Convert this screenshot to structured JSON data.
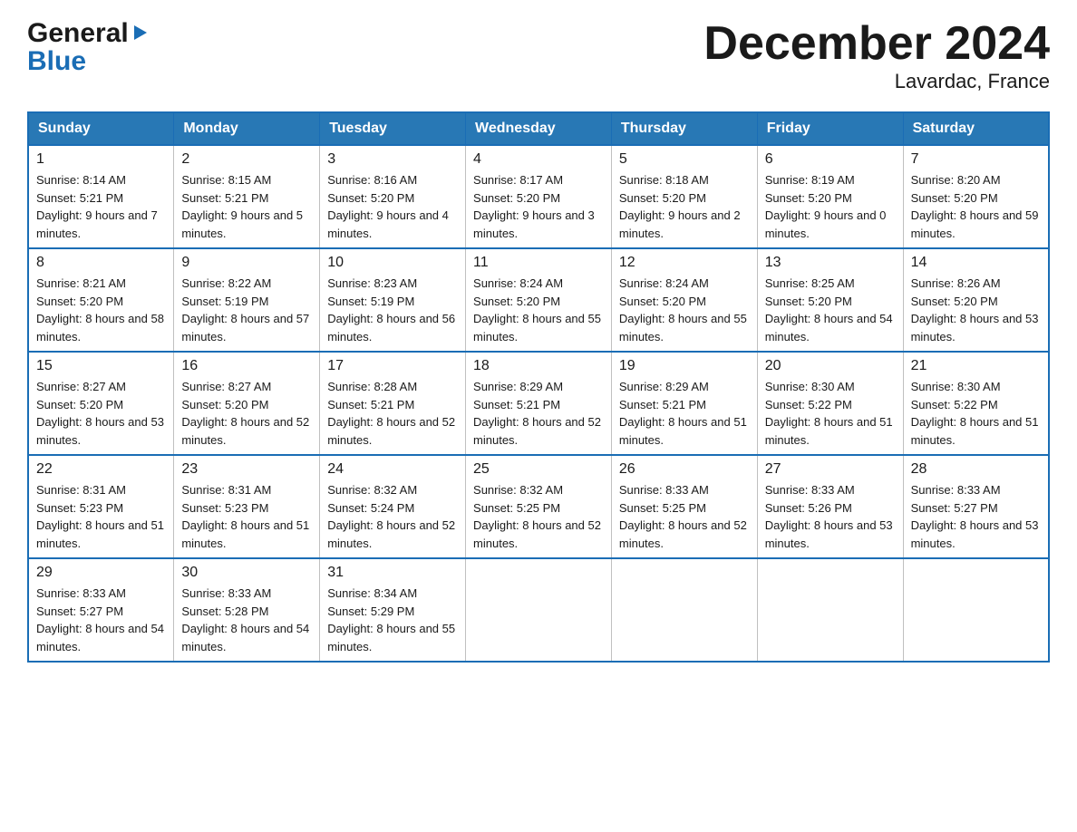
{
  "logo": {
    "general": "General",
    "triangle": "▶",
    "blue": "Blue"
  },
  "title": "December 2024",
  "subtitle": "Lavardac, France",
  "days": [
    "Sunday",
    "Monday",
    "Tuesday",
    "Wednesday",
    "Thursday",
    "Friday",
    "Saturday"
  ],
  "weeks": [
    [
      {
        "num": "1",
        "sunrise": "8:14 AM",
        "sunset": "5:21 PM",
        "daylight": "9 hours and 7 minutes."
      },
      {
        "num": "2",
        "sunrise": "8:15 AM",
        "sunset": "5:21 PM",
        "daylight": "9 hours and 5 minutes."
      },
      {
        "num": "3",
        "sunrise": "8:16 AM",
        "sunset": "5:20 PM",
        "daylight": "9 hours and 4 minutes."
      },
      {
        "num": "4",
        "sunrise": "8:17 AM",
        "sunset": "5:20 PM",
        "daylight": "9 hours and 3 minutes."
      },
      {
        "num": "5",
        "sunrise": "8:18 AM",
        "sunset": "5:20 PM",
        "daylight": "9 hours and 2 minutes."
      },
      {
        "num": "6",
        "sunrise": "8:19 AM",
        "sunset": "5:20 PM",
        "daylight": "9 hours and 0 minutes."
      },
      {
        "num": "7",
        "sunrise": "8:20 AM",
        "sunset": "5:20 PM",
        "daylight": "8 hours and 59 minutes."
      }
    ],
    [
      {
        "num": "8",
        "sunrise": "8:21 AM",
        "sunset": "5:20 PM",
        "daylight": "8 hours and 58 minutes."
      },
      {
        "num": "9",
        "sunrise": "8:22 AM",
        "sunset": "5:19 PM",
        "daylight": "8 hours and 57 minutes."
      },
      {
        "num": "10",
        "sunrise": "8:23 AM",
        "sunset": "5:19 PM",
        "daylight": "8 hours and 56 minutes."
      },
      {
        "num": "11",
        "sunrise": "8:24 AM",
        "sunset": "5:20 PM",
        "daylight": "8 hours and 55 minutes."
      },
      {
        "num": "12",
        "sunrise": "8:24 AM",
        "sunset": "5:20 PM",
        "daylight": "8 hours and 55 minutes."
      },
      {
        "num": "13",
        "sunrise": "8:25 AM",
        "sunset": "5:20 PM",
        "daylight": "8 hours and 54 minutes."
      },
      {
        "num": "14",
        "sunrise": "8:26 AM",
        "sunset": "5:20 PM",
        "daylight": "8 hours and 53 minutes."
      }
    ],
    [
      {
        "num": "15",
        "sunrise": "8:27 AM",
        "sunset": "5:20 PM",
        "daylight": "8 hours and 53 minutes."
      },
      {
        "num": "16",
        "sunrise": "8:27 AM",
        "sunset": "5:20 PM",
        "daylight": "8 hours and 52 minutes."
      },
      {
        "num": "17",
        "sunrise": "8:28 AM",
        "sunset": "5:21 PM",
        "daylight": "8 hours and 52 minutes."
      },
      {
        "num": "18",
        "sunrise": "8:29 AM",
        "sunset": "5:21 PM",
        "daylight": "8 hours and 52 minutes."
      },
      {
        "num": "19",
        "sunrise": "8:29 AM",
        "sunset": "5:21 PM",
        "daylight": "8 hours and 51 minutes."
      },
      {
        "num": "20",
        "sunrise": "8:30 AM",
        "sunset": "5:22 PM",
        "daylight": "8 hours and 51 minutes."
      },
      {
        "num": "21",
        "sunrise": "8:30 AM",
        "sunset": "5:22 PM",
        "daylight": "8 hours and 51 minutes."
      }
    ],
    [
      {
        "num": "22",
        "sunrise": "8:31 AM",
        "sunset": "5:23 PM",
        "daylight": "8 hours and 51 minutes."
      },
      {
        "num": "23",
        "sunrise": "8:31 AM",
        "sunset": "5:23 PM",
        "daylight": "8 hours and 51 minutes."
      },
      {
        "num": "24",
        "sunrise": "8:32 AM",
        "sunset": "5:24 PM",
        "daylight": "8 hours and 52 minutes."
      },
      {
        "num": "25",
        "sunrise": "8:32 AM",
        "sunset": "5:25 PM",
        "daylight": "8 hours and 52 minutes."
      },
      {
        "num": "26",
        "sunrise": "8:33 AM",
        "sunset": "5:25 PM",
        "daylight": "8 hours and 52 minutes."
      },
      {
        "num": "27",
        "sunrise": "8:33 AM",
        "sunset": "5:26 PM",
        "daylight": "8 hours and 53 minutes."
      },
      {
        "num": "28",
        "sunrise": "8:33 AM",
        "sunset": "5:27 PM",
        "daylight": "8 hours and 53 minutes."
      }
    ],
    [
      {
        "num": "29",
        "sunrise": "8:33 AM",
        "sunset": "5:27 PM",
        "daylight": "8 hours and 54 minutes."
      },
      {
        "num": "30",
        "sunrise": "8:33 AM",
        "sunset": "5:28 PM",
        "daylight": "8 hours and 54 minutes."
      },
      {
        "num": "31",
        "sunrise": "8:34 AM",
        "sunset": "5:29 PM",
        "daylight": "8 hours and 55 minutes."
      },
      null,
      null,
      null,
      null
    ]
  ]
}
